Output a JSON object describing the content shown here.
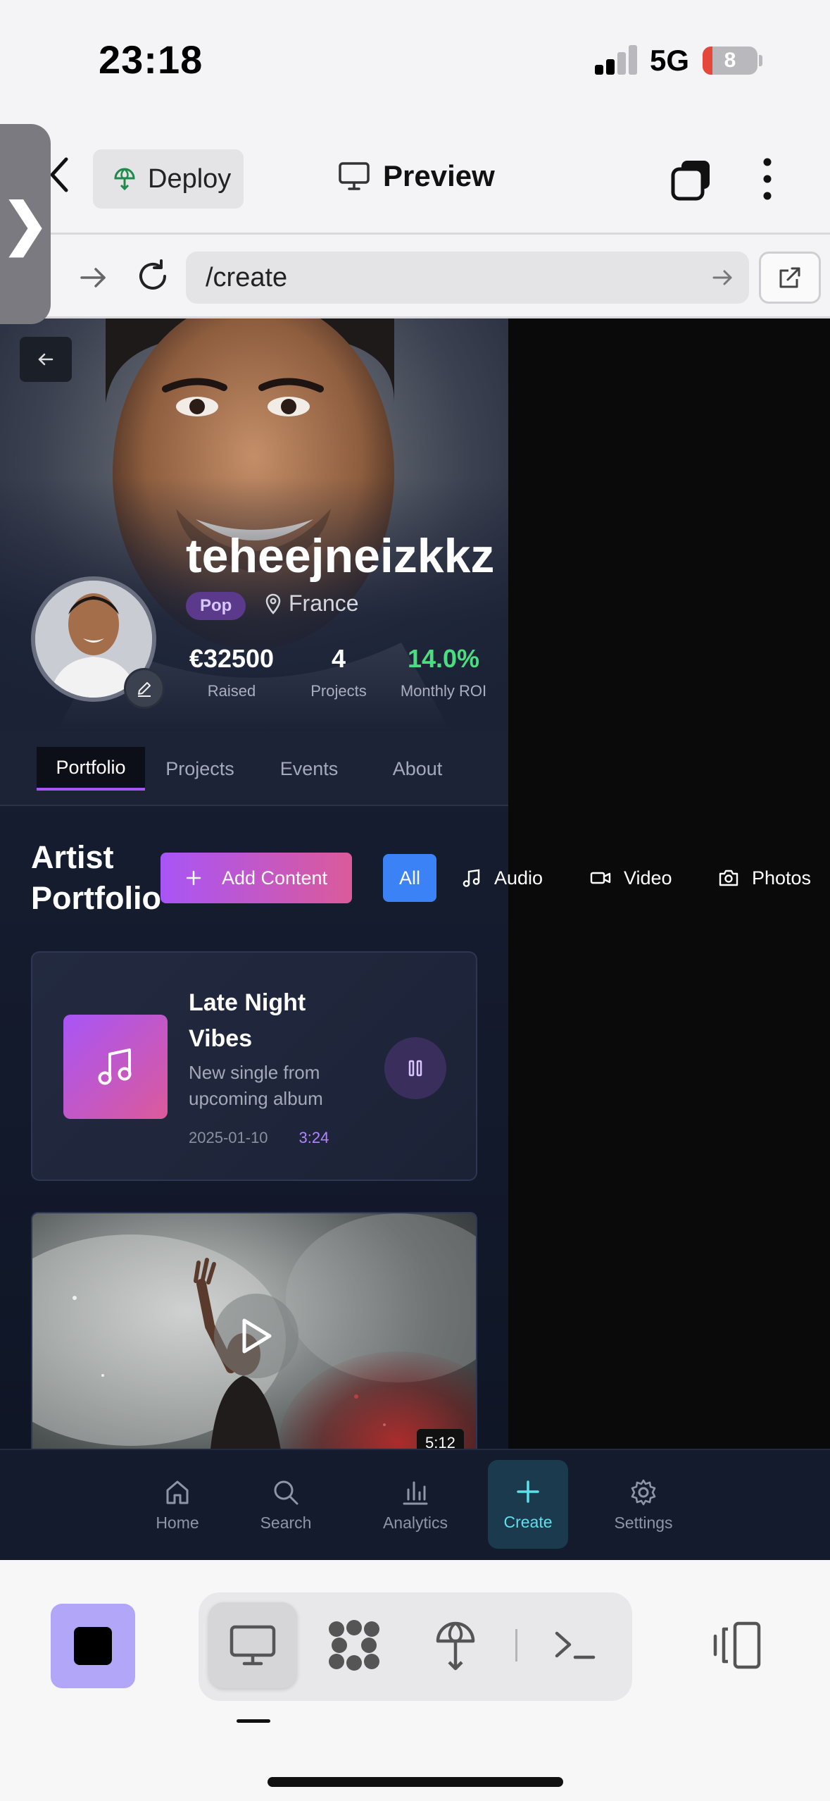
{
  "status_bar": {
    "time": "23:18",
    "network": "5G",
    "battery": "8"
  },
  "toolbar": {
    "deploy_label": "Deploy",
    "preview_label": "Preview"
  },
  "url_bar": {
    "url": "/create"
  },
  "drawer": {
    "handle_glyph": "❯"
  },
  "profile": {
    "name": "teheejneizkkz",
    "genre": "Pop",
    "location": "France",
    "stats": [
      {
        "value": "€32500",
        "label": "Raised"
      },
      {
        "value": "4",
        "label": "Projects"
      },
      {
        "value": "14.0%",
        "label": "Monthly ROI",
        "color": "#4ade80"
      }
    ]
  },
  "tabs": [
    "Portfolio",
    "Projects",
    "Events",
    "About"
  ],
  "portfolio": {
    "title_line1": "Artist",
    "title_line2": "Portfolio",
    "add_label": "Add Content",
    "filters": [
      "All",
      "Audio",
      "Video",
      "Photos"
    ]
  },
  "audio_item": {
    "title": "Late Night Vibes",
    "description": "New single from upcoming album",
    "date": "2025-01-10",
    "duration": "3:24"
  },
  "video_item": {
    "duration": "5:12"
  },
  "bottom_nav": [
    "Home",
    "Search",
    "Analytics",
    "Create",
    "Settings"
  ],
  "colors": {
    "accent": "#a855f7",
    "blue": "#3b82f6",
    "teal": "#5ee0ea",
    "roi": "#4ade80"
  }
}
